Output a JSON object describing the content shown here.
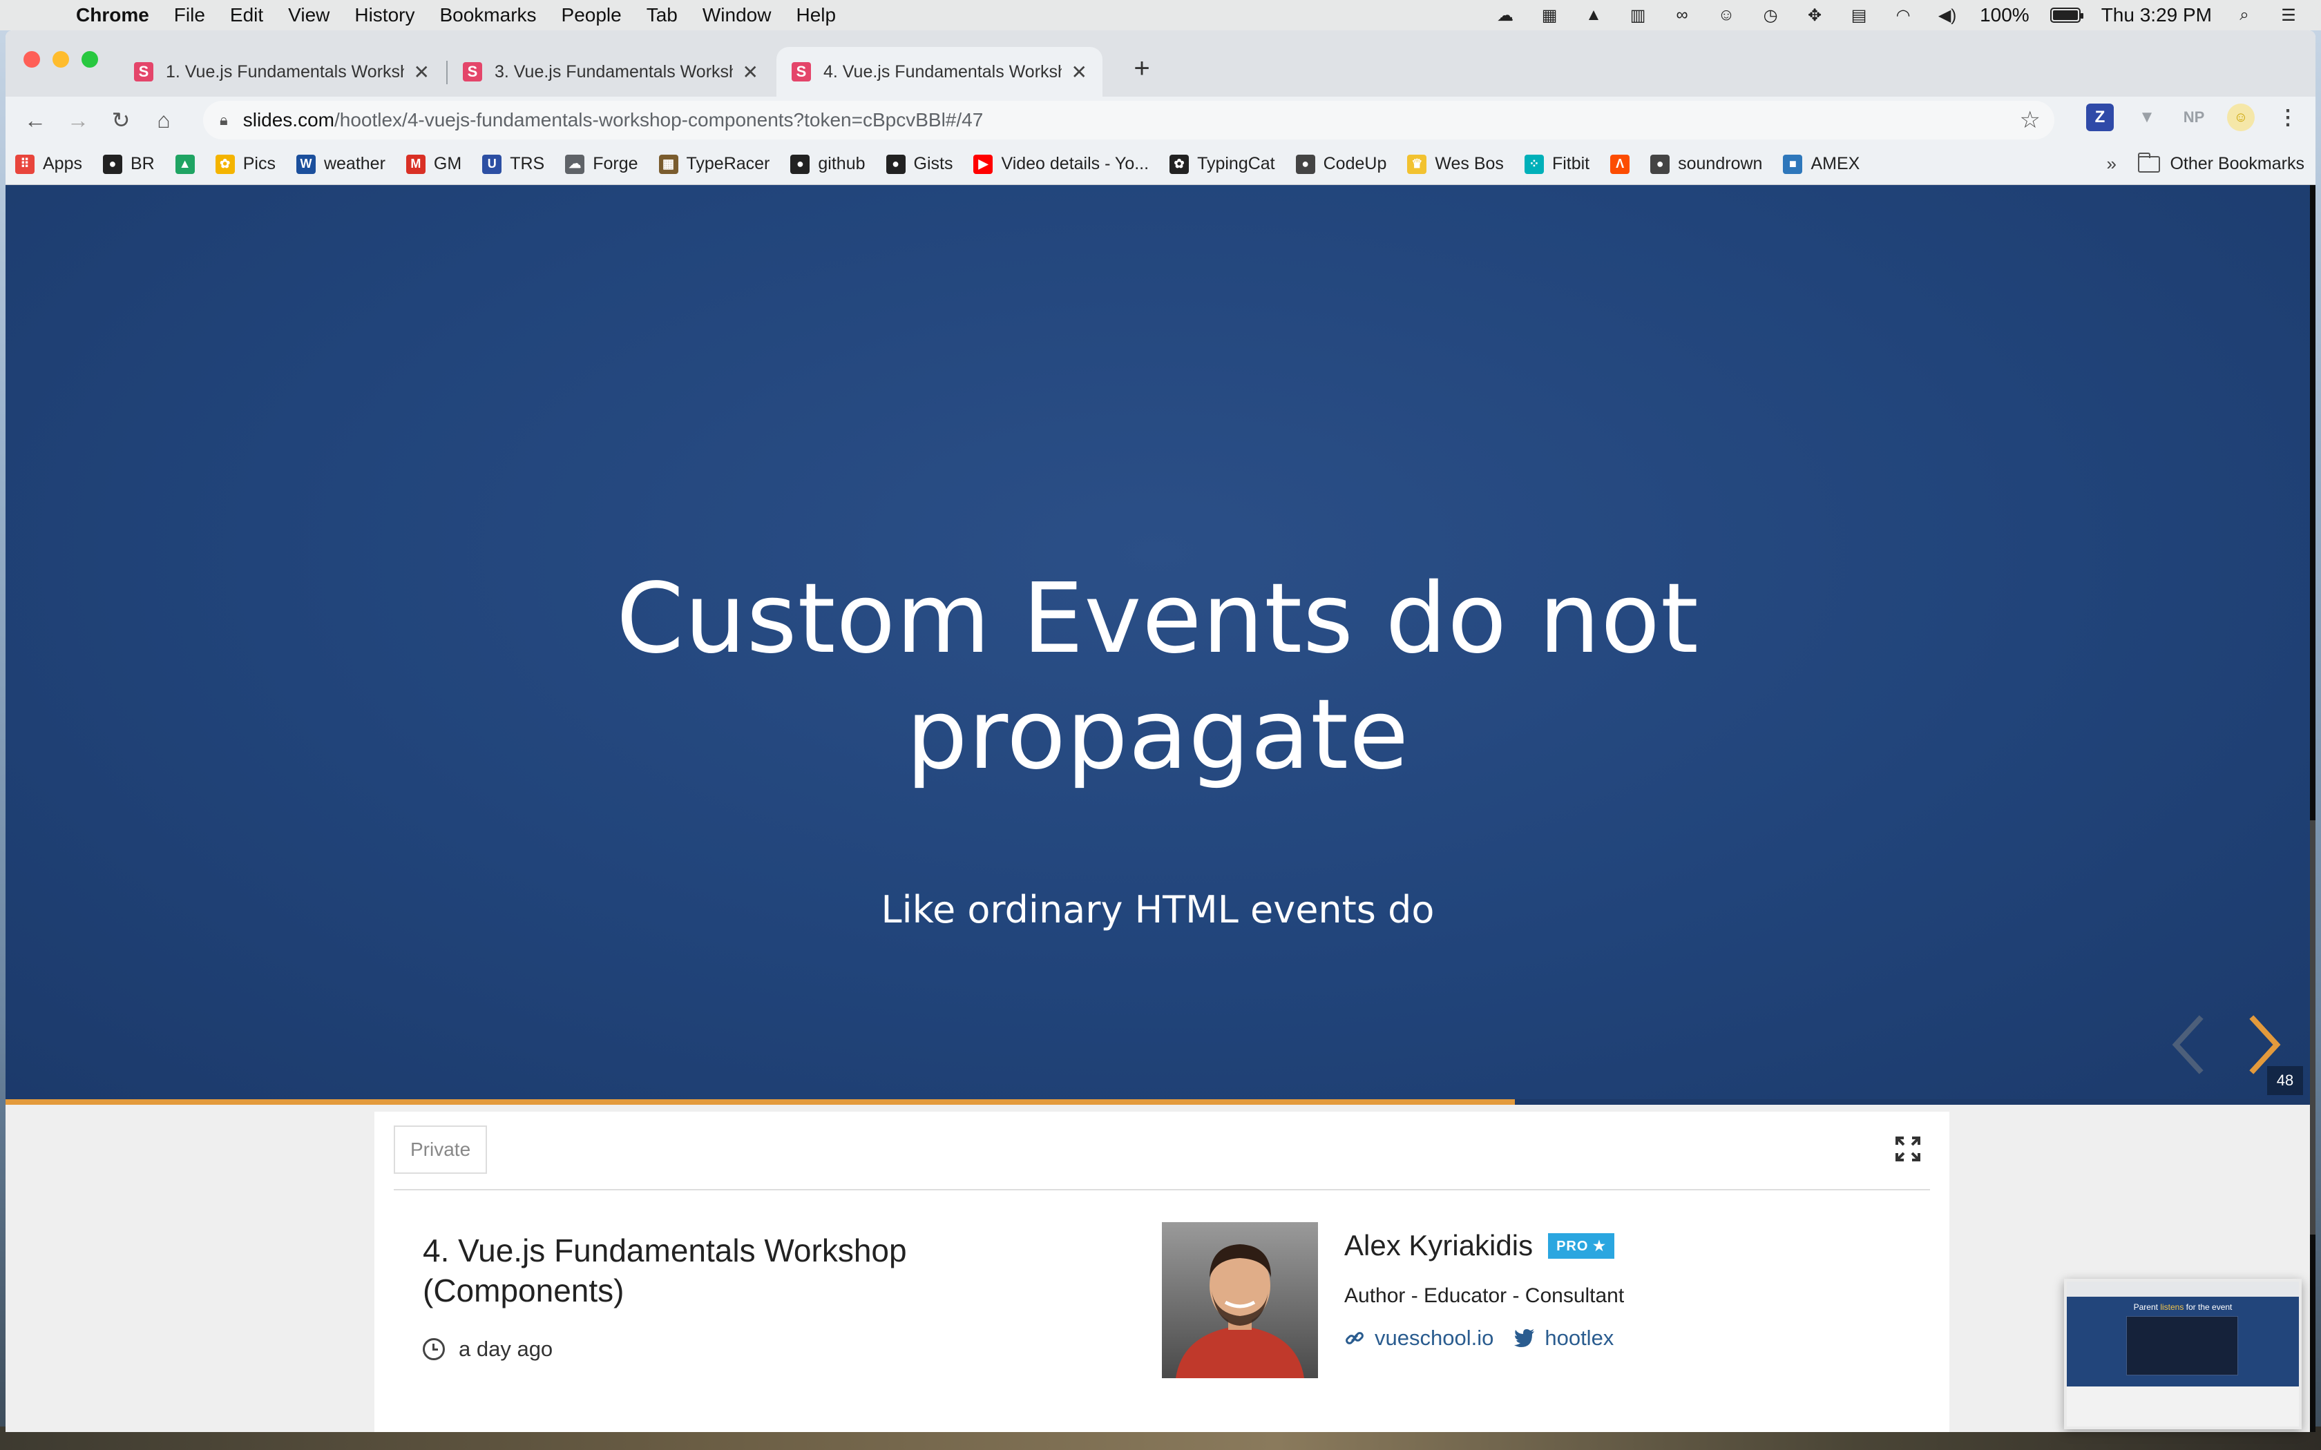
{
  "menubar": {
    "app_name": "Chrome",
    "items": [
      "File",
      "Edit",
      "View",
      "History",
      "Bookmarks",
      "People",
      "Tab",
      "Window",
      "Help"
    ],
    "battery_percent": "100%",
    "battery_level": 1.0,
    "clock": "Thu 3:29 PM"
  },
  "browser": {
    "tabs": [
      {
        "favicon": "S",
        "title": "1. Vue.js Fundamentals Worksh",
        "close": "✕"
      },
      {
        "favicon": "S",
        "title": "3. Vue.js Fundamentals Worksh",
        "close": "✕"
      },
      {
        "favicon": "S",
        "title": "4. Vue.js Fundamentals Worksh",
        "close": "✕"
      }
    ],
    "active_tab_index": 2,
    "new_tab": "+",
    "url_host": "slides.com",
    "url_path": "/hootlex/4-vuejs-fundamentals-workshop-components?token=cBpcvBBl#/47",
    "extensions": [
      {
        "label": "Z",
        "color": "#2f4aa8"
      },
      {
        "label": "▼",
        "color": "#9aa0a6"
      },
      {
        "label": "NP",
        "color": "#9aa0a6"
      }
    ]
  },
  "bookmarks": {
    "items": [
      {
        "label": "Apps",
        "icon": "apps-grid-icon",
        "color": "#e8453c"
      },
      {
        "label": "BR",
        "icon": "github-icon",
        "color": "#222222"
      },
      {
        "label": "",
        "icon": "google-drive-icon",
        "color": "#1fa463"
      },
      {
        "label": "Pics",
        "icon": "google-photos-icon",
        "color": "#f4b400"
      },
      {
        "label": "weather",
        "icon": "weather-channel-icon",
        "color": "#1b4f9c"
      },
      {
        "label": "GM",
        "icon": "gmail-icon",
        "color": "#d93025"
      },
      {
        "label": "TRS",
        "icon": "uc-icon",
        "color": "#2c4fa3"
      },
      {
        "label": "Forge",
        "icon": "forge-cloud-icon",
        "color": "#5f6368"
      },
      {
        "label": "TypeRacer",
        "icon": "typeracer-icon",
        "color": "#7a5c2e"
      },
      {
        "label": "github",
        "icon": "github-icon",
        "color": "#222222"
      },
      {
        "label": "Gists",
        "icon": "github-icon",
        "color": "#222222"
      },
      {
        "label": "Video details - Yo...",
        "icon": "youtube-icon",
        "color": "#ff0000"
      },
      {
        "label": "TypingCat",
        "icon": "paw-icon",
        "color": "#222222"
      },
      {
        "label": "CodeUp",
        "icon": "globe-icon",
        "color": "#444444"
      },
      {
        "label": "Wes Bos",
        "icon": "crown-icon",
        "color": "#f2c230"
      },
      {
        "label": "Fitbit",
        "icon": "fitbit-icon",
        "color": "#00b0b9"
      },
      {
        "label": "",
        "icon": "strava-icon",
        "color": "#fc4c02"
      },
      {
        "label": "soundrown",
        "icon": "globe-icon",
        "color": "#444444"
      },
      {
        "label": "AMEX",
        "icon": "amex-icon",
        "color": "#2e77bb"
      }
    ],
    "more": "»",
    "other": "Other Bookmarks"
  },
  "slide": {
    "title_line1": "Custom Events do not",
    "title_line2": "propagate",
    "subtitle": "Like ordinary HTML events do",
    "slide_number": "48",
    "progress": 0.655
  },
  "deck": {
    "visibility": "Private",
    "title": "4. Vue.js Fundamentals Workshop (Components)",
    "time": "a day ago",
    "author": {
      "name": "Alex Kyriakidis",
      "badge": "PRO ★",
      "role": "Author - Educator - Consultant",
      "website": "vueschool.io",
      "twitter": "hootlex"
    }
  },
  "thumbnail": {
    "title_prefix": "Parent ",
    "title_highlight": "listens",
    "title_suffix": " for the event"
  }
}
